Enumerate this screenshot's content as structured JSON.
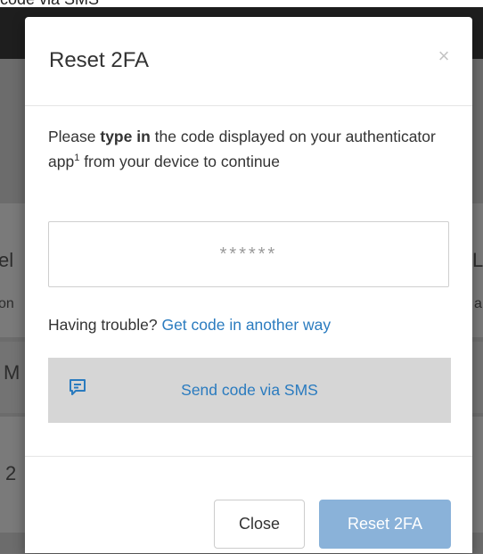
{
  "background": {
    "top_caption": "code via SMS",
    "fragments_left": [
      "el",
      "on",
      "M",
      "2"
    ],
    "fragments_right": [
      "L",
      "a"
    ]
  },
  "modal": {
    "title": "Reset 2FA",
    "close_glyph": "×",
    "instructions": {
      "part1": "Please ",
      "bold": "type in",
      "part2": " the code displayed on your authenticator app",
      "superscript": "1",
      "part3": " from your device to continue"
    },
    "code_input": {
      "placeholder": "******",
      "value": ""
    },
    "trouble_text": "Having trouble?",
    "trouble_link": "Get code in another way",
    "sms_option": {
      "icon": "chat-message-icon",
      "label": "Send code via SMS"
    },
    "footer": {
      "close_label": "Close",
      "reset_label": "Reset 2FA"
    }
  },
  "colors": {
    "link": "#2a7bbf",
    "primary_button": "#8ab2d9",
    "sms_background": "#d6d6d6",
    "overlay": "#6c6c6c"
  }
}
